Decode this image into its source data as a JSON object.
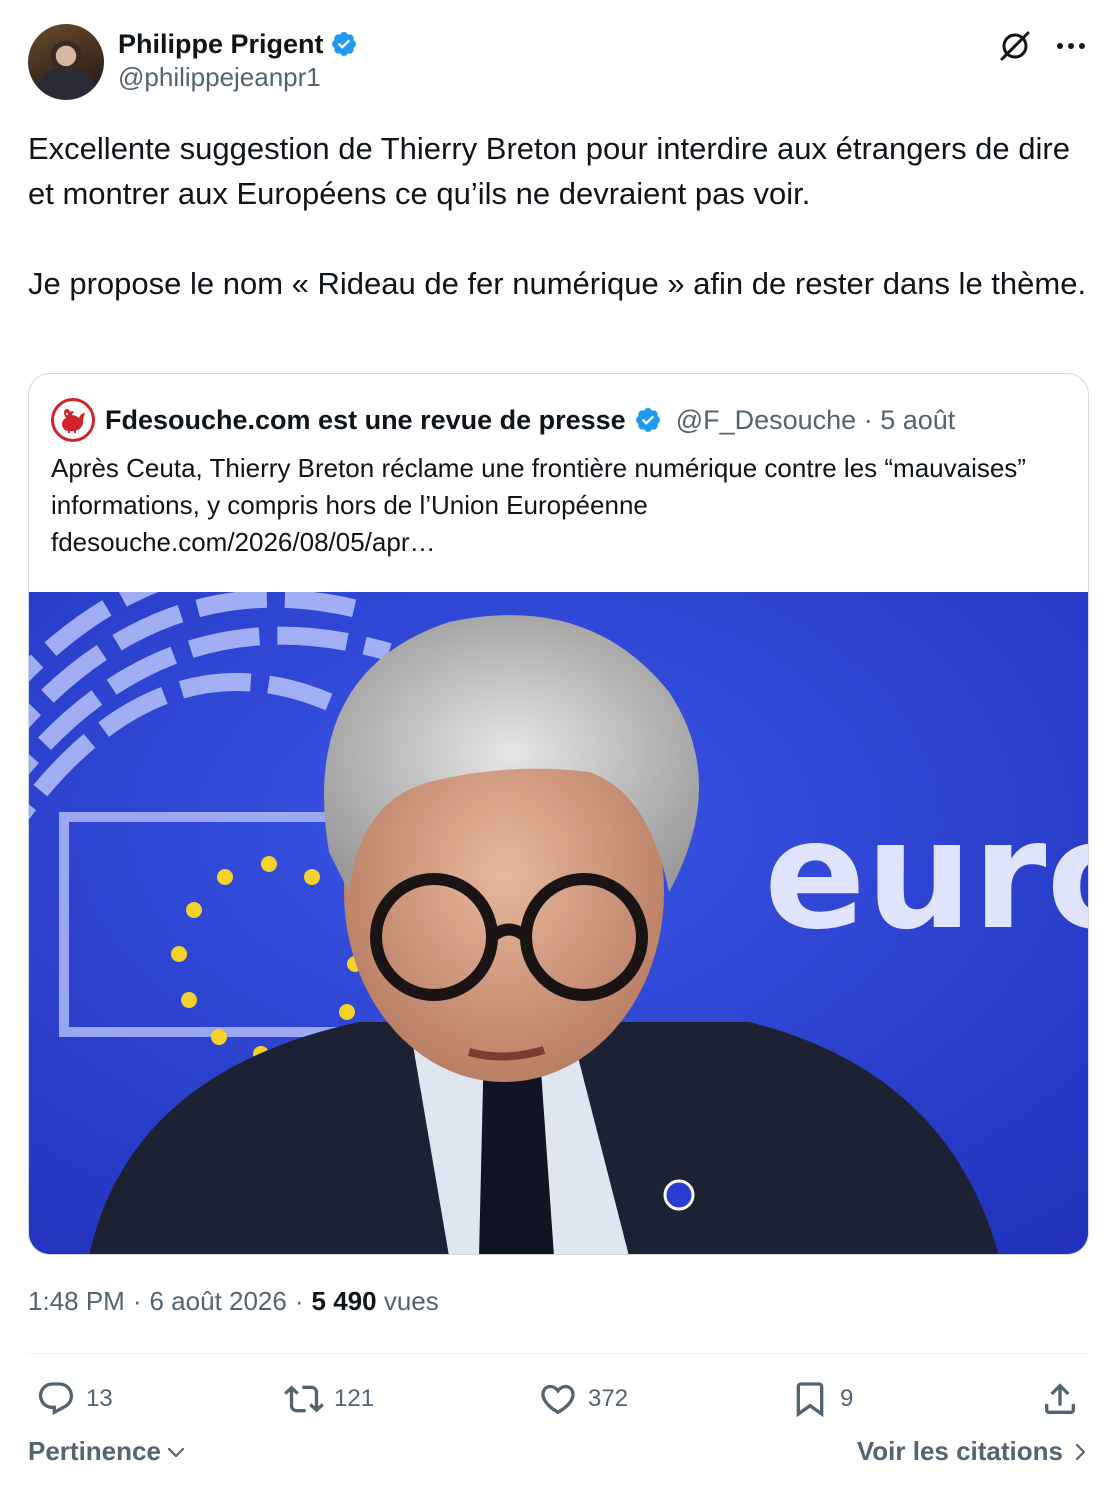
{
  "author": {
    "name": "Philippe Prigent",
    "handle": "@philippejeanpr1",
    "verified": true
  },
  "tweet": {
    "paragraphs": [
      "Excellente suggestion de Thierry Breton pour interdire aux étrangers de dire et montrer aux Européens ce qu’ils ne devraient pas voir.",
      "Je propose le nom « Rideau de fer numérique » afin de rester dans le thème."
    ]
  },
  "quote": {
    "name": "Fdesouche.com est une revue de presse",
    "handle": "@F_Desouche · 5 août",
    "text": "Après Ceuta, Thierry Breton réclame une frontière numérique contre les “mauvaises” informations, y compris hors de l’Union Européenne",
    "link": "fdesouche.com/2026/08/05/apr…",
    "image_word": "euro"
  },
  "meta": {
    "time": "1:48 PM",
    "sep1": "·",
    "date": "6 août 2026",
    "sep2": "·",
    "views_count": "5 490",
    "views_label": "vues"
  },
  "actions": {
    "replies": "13",
    "reposts": "121",
    "likes": "372",
    "bookmarks": "9"
  },
  "footer": {
    "sort_label": "Pertinence",
    "quotes_label": "Voir les citations"
  },
  "colors": {
    "verified": "#1d9bf0",
    "muted": "#536471",
    "text": "#0f1419",
    "border": "#cfd9de",
    "brand_red": "#d2232a",
    "eu_blue": "#2c3fd6"
  },
  "icons": [
    "verified-badge-icon",
    "grok-icon",
    "more-icon",
    "rooster-icon",
    "reply-icon",
    "repost-icon",
    "like-icon",
    "bookmark-icon",
    "share-icon",
    "chevron-down-icon",
    "chevron-right-icon"
  ]
}
